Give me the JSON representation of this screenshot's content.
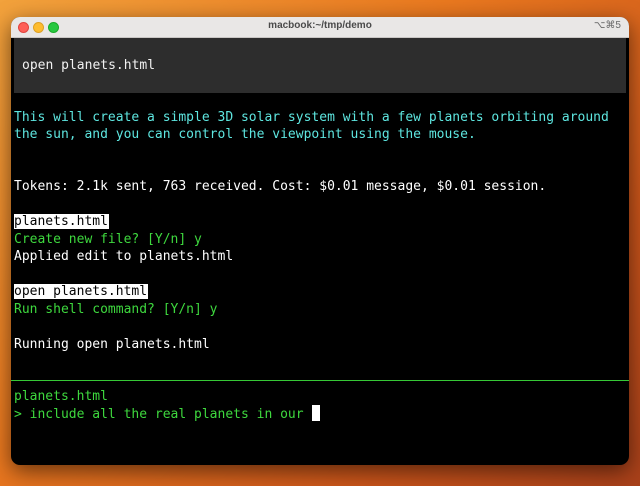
{
  "window": {
    "title": "macbook:~/tmp/demo",
    "shortcut": "⌥⌘5"
  },
  "terminal": {
    "code_block": "open planets.html",
    "message_line1": "This will create a simple 3D solar system with a few planets orbiting around",
    "message_line2": "the sun, and you can control the viewpoint using the mouse.",
    "tokens_line": "Tokens: 2.1k sent, 763 received. Cost: $0.01 message, $0.01 session.",
    "file_highlight": "planets.html",
    "create_prompt": "Create new file? [Y/n] y",
    "applied_edit": "Applied edit to planets.html",
    "command_highlight": "open planets.html",
    "shell_prompt": "Run shell command? [Y/n] y",
    "running_line": "Running open planets.html",
    "input_filename": "planets.html",
    "input_prompt_marker": ">",
    "input_value": "include all the real planets in our"
  },
  "colors": {
    "terminal_bg": "#000000",
    "code_block_bg": "#2d2d2d",
    "assistant_text": "#5ee6e0",
    "prompt_text": "#3ed83e",
    "wallpaper": "#e9781f"
  }
}
